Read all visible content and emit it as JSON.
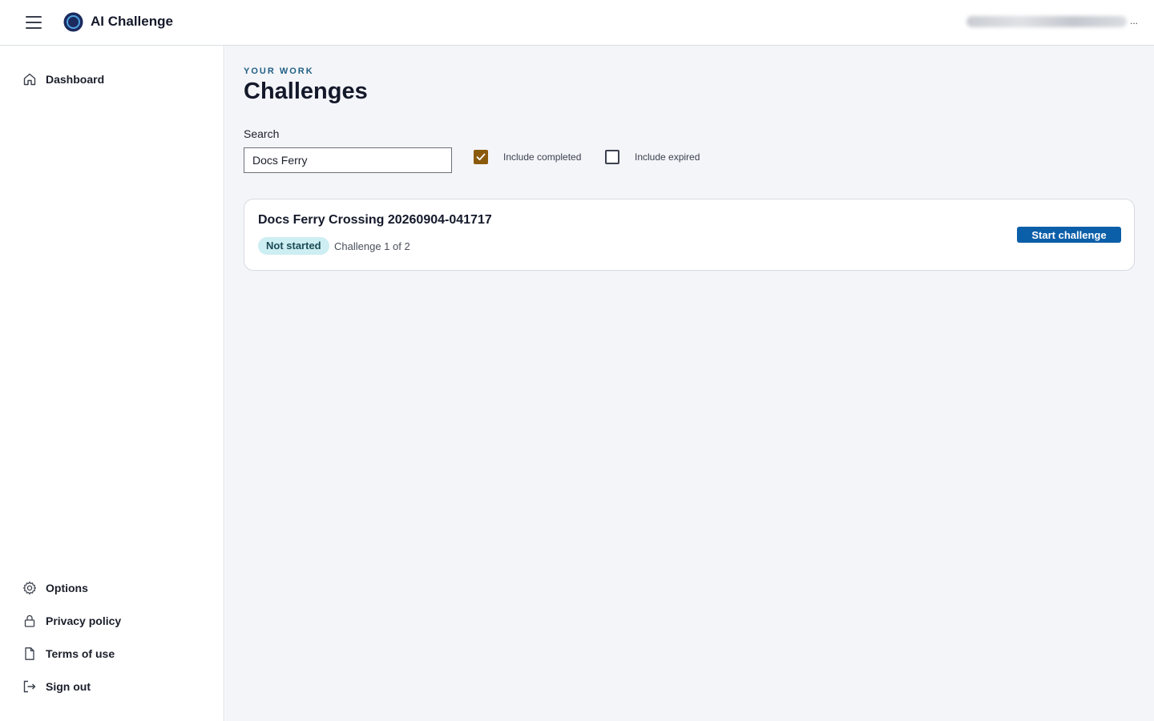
{
  "app": {
    "title": "AI Challenge",
    "user_ellipsis": "..."
  },
  "sidebar": {
    "top_items": [
      {
        "label": "Dashboard",
        "icon": "home-icon"
      }
    ],
    "bottom_items": [
      {
        "label": "Options",
        "icon": "gear-icon"
      },
      {
        "label": "Privacy policy",
        "icon": "lock-icon"
      },
      {
        "label": "Terms of use",
        "icon": "document-icon"
      },
      {
        "label": "Sign out",
        "icon": "sign-out-icon"
      }
    ]
  },
  "main": {
    "eyebrow": "YOUR WORK",
    "title": "Challenges",
    "search": {
      "label": "Search",
      "value": "Docs Ferry"
    },
    "filters": [
      {
        "label": "Include completed",
        "checked": true
      },
      {
        "label": "Include expired",
        "checked": false
      }
    ],
    "challenges": [
      {
        "title": "Docs Ferry Crossing 20260904-041717",
        "status": "Not started",
        "progress": "Challenge 1 of 2",
        "action": "Start challenge"
      }
    ]
  },
  "colors": {
    "accent": "#0b5ea8",
    "eyebrow": "#1f5f84",
    "checkbox_checked": "#8a5a0c",
    "badge_bg": "#cdeef2",
    "content_bg": "#f4f5f9"
  }
}
